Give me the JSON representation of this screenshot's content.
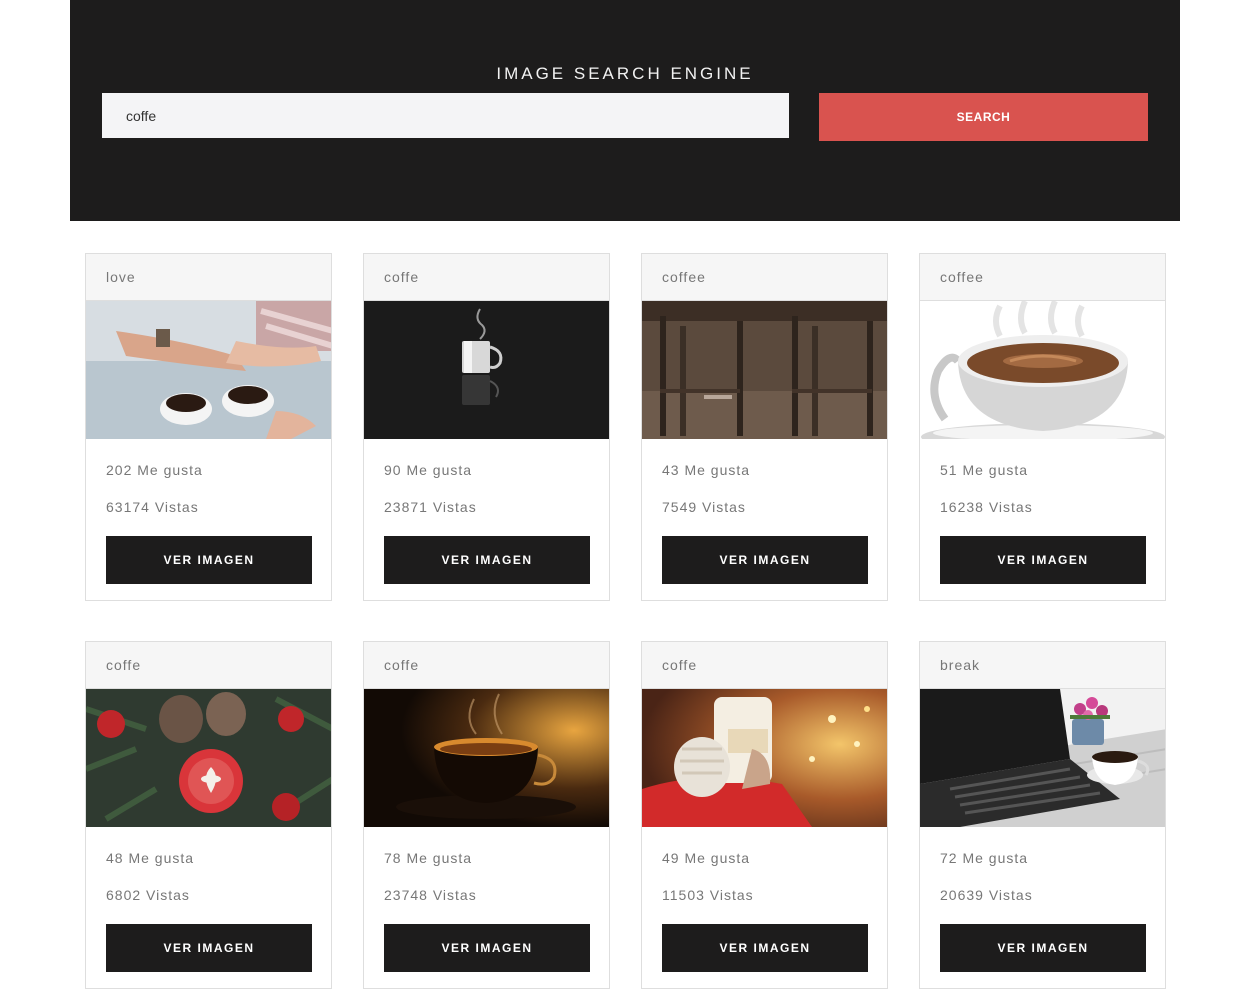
{
  "header": {
    "title": "IMAGE SEARCH ENGINE",
    "search_value": "coffe",
    "search_button": "SEARCH"
  },
  "cards": [
    {
      "tag": "love",
      "likes": "202 Me gusta",
      "views": "63174 Vistas",
      "button": "VER IMAGEN"
    },
    {
      "tag": "coffe",
      "likes": "90 Me gusta",
      "views": "23871 Vistas",
      "button": "VER IMAGEN"
    },
    {
      "tag": "coffee",
      "likes": "43 Me gusta",
      "views": "7549 Vistas",
      "button": "VER IMAGEN"
    },
    {
      "tag": "coffee",
      "likes": "51 Me gusta",
      "views": "16238 Vistas",
      "button": "VER IMAGEN"
    },
    {
      "tag": "coffe",
      "likes": "48 Me gusta",
      "views": "6802 Vistas",
      "button": "VER IMAGEN"
    },
    {
      "tag": "coffe",
      "likes": "78 Me gusta",
      "views": "23748 Vistas",
      "button": "VER IMAGEN"
    },
    {
      "tag": "coffe",
      "likes": "49 Me gusta",
      "views": "11503 Vistas",
      "button": "VER IMAGEN"
    },
    {
      "tag": "break",
      "likes": "72 Me gusta",
      "views": "20639 Vistas",
      "button": "VER IMAGEN"
    }
  ],
  "colors": {
    "header_bg": "#1d1c1c",
    "search_button": "#d9534f",
    "card_button": "#1d1c1c"
  }
}
